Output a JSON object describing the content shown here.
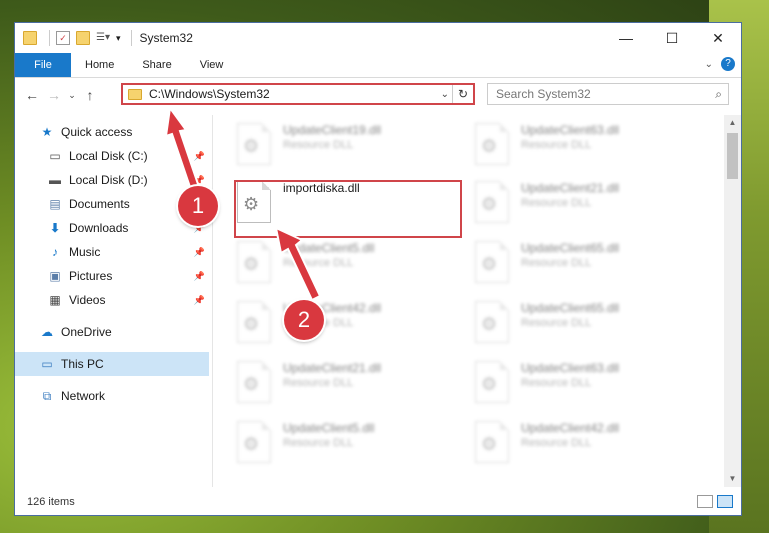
{
  "window": {
    "title": "System32"
  },
  "ribbon": {
    "tabs": [
      "File",
      "Home",
      "Share",
      "View"
    ],
    "help": "?"
  },
  "address": {
    "path": "C:\\Windows\\System32"
  },
  "search": {
    "placeholder": "Search System32"
  },
  "sidebar": {
    "items": [
      {
        "label": "Quick access"
      },
      {
        "label": "Local Disk (C:)"
      },
      {
        "label": "Local Disk (D:)"
      },
      {
        "label": "Documents"
      },
      {
        "label": "Downloads"
      },
      {
        "label": "Music"
      },
      {
        "label": "Pictures"
      },
      {
        "label": "Videos"
      },
      {
        "label": "OneDrive"
      },
      {
        "label": "This PC"
      },
      {
        "label": "Network"
      }
    ]
  },
  "files": [
    {
      "name": "UpdateClient19.dll",
      "type": "Resource DLL"
    },
    {
      "name": "UpdateClient63.dll",
      "type": "Resource DLL"
    },
    {
      "name": "importdiska.dll",
      "type": ""
    },
    {
      "name": "UpdateClient21.dll",
      "type": "Resource DLL"
    },
    {
      "name": "UpdateClient5.dll",
      "type": "Resource DLL"
    },
    {
      "name": "UpdateClient65.dll",
      "type": "Resource DLL"
    },
    {
      "name": "UpdateClient42.dll",
      "type": "Resource DLL"
    },
    {
      "name": "UpdateClient65.dll",
      "type": "Resource DLL"
    },
    {
      "name": "UpdateClient21.dll",
      "type": "Resource DLL"
    },
    {
      "name": "UpdateClient63.dll",
      "type": "Resource DLL"
    },
    {
      "name": "UpdateClient5.dll",
      "type": "Resource DLL"
    },
    {
      "name": "UpdateClient42.dll",
      "type": "Resource DLL"
    }
  ],
  "status": {
    "items_count": "126 items"
  },
  "annotations": {
    "step1": "1",
    "step2": "2"
  },
  "colors": {
    "accent": "#1979ca",
    "highlight": "#d0454a"
  }
}
